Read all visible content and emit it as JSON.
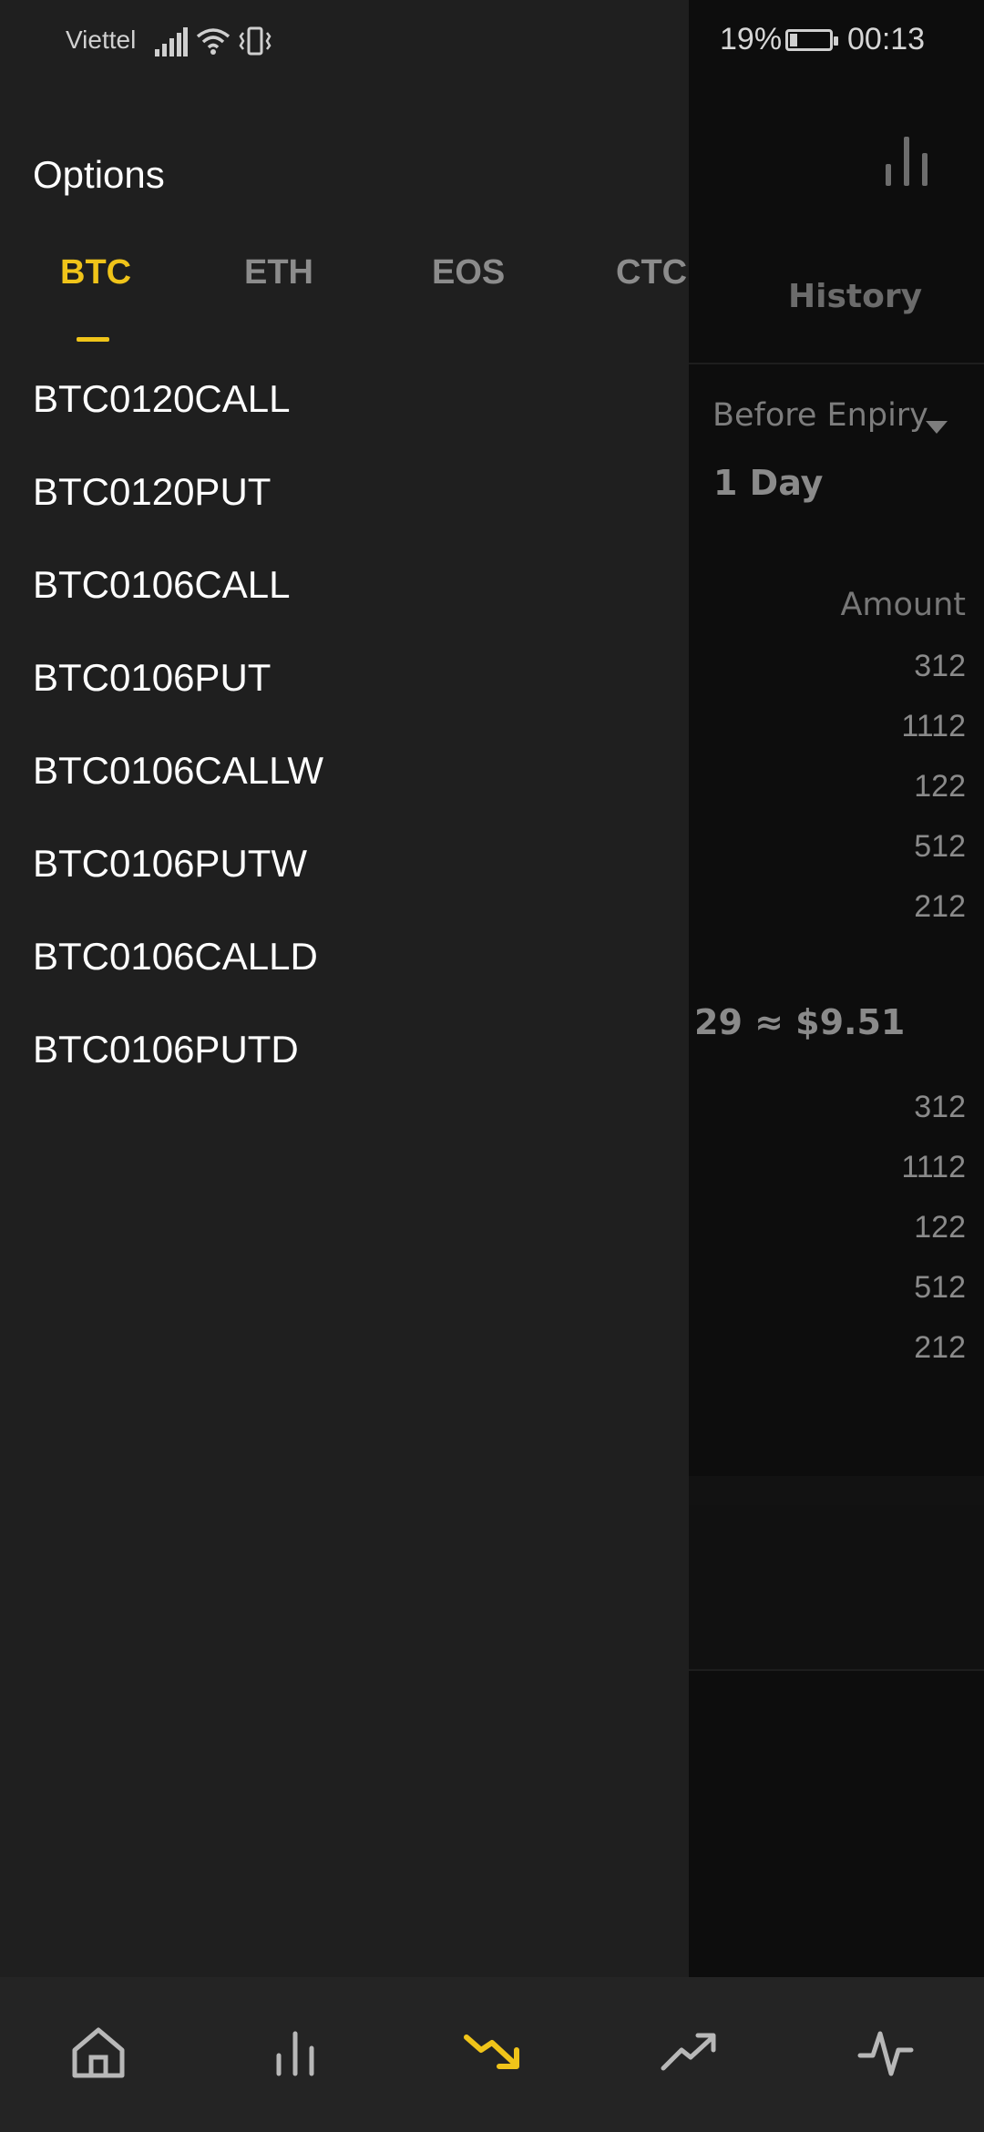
{
  "status_bar": {
    "carrier": "Viettel",
    "battery": "19%",
    "battery_level": 0.19,
    "time": "00:13"
  },
  "drawer": {
    "title": "Options",
    "tabs": [
      "BTC",
      "ETH",
      "EOS",
      "CTC"
    ],
    "active_tab": "BTC",
    "contracts": [
      "BTC0120CALL",
      "BTC0120PUT",
      "BTC0106CALL",
      "BTC0106PUT",
      "BTC0106CALLW",
      "BTC0106PUTW",
      "BTC0106CALLD",
      "BTC0106PUTD"
    ]
  },
  "background": {
    "history_tab": "History",
    "expiry_label": "Before Enpiry",
    "expiry_value": "1 Day",
    "amount_header": "Amount",
    "upper_amounts": [
      "312",
      "1112",
      "122",
      "512",
      "212"
    ],
    "price": "29 ≈ $9.51",
    "lower_amounts": [
      "312",
      "1112",
      "122",
      "512",
      "212"
    ]
  },
  "bottom_nav": {
    "items": [
      "home-icon",
      "markets-icon",
      "options-icon",
      "trade-icon",
      "activity-icon"
    ],
    "active": "options-icon",
    "accent": "#f0c419",
    "inactive": "#b8b8b8"
  }
}
